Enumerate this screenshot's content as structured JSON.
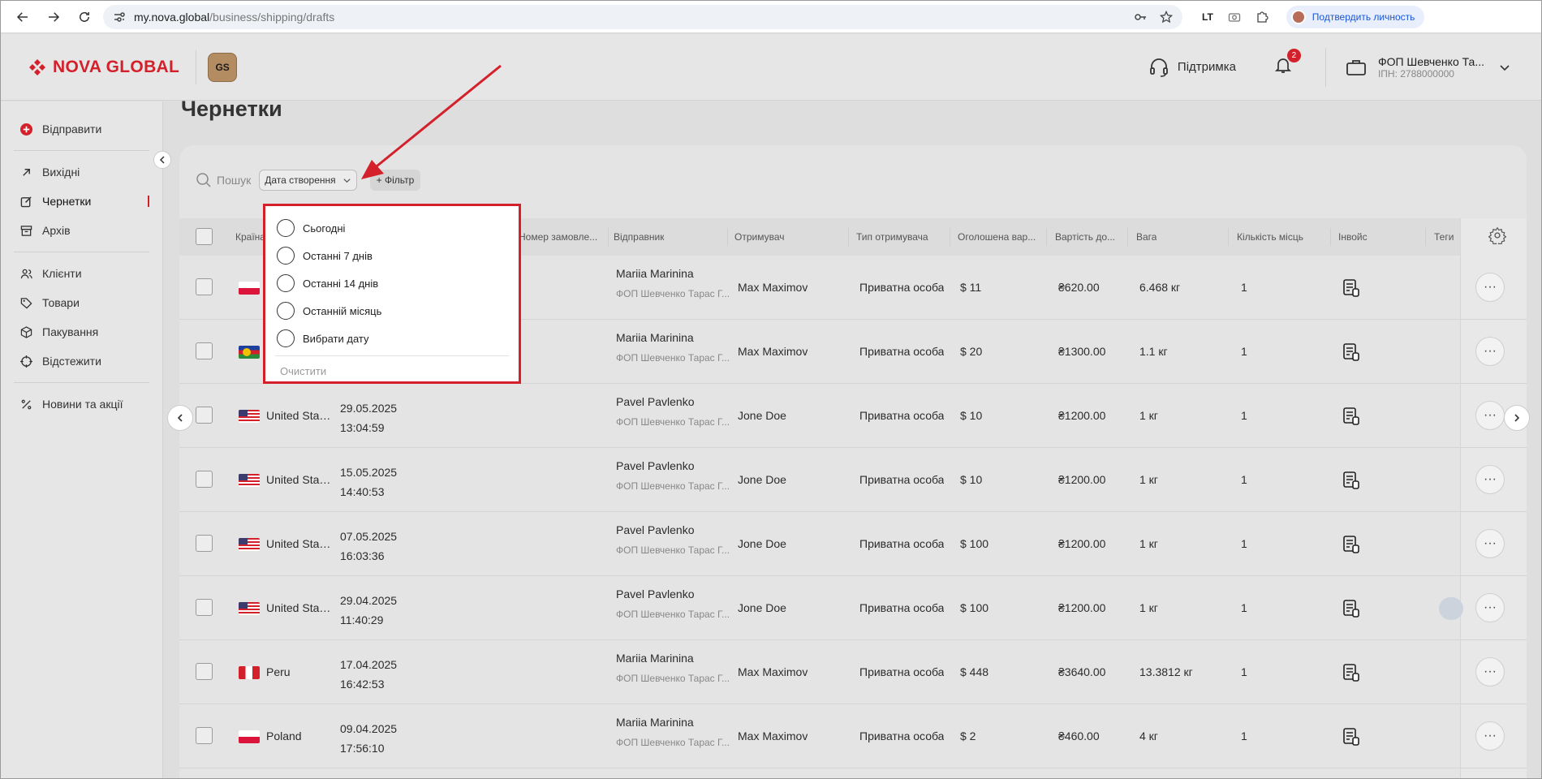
{
  "browser": {
    "url_host": "my.nova.global",
    "url_path": "/business/shipping/drafts",
    "ext_text": "LT",
    "profile_label": "Подтвердить личность"
  },
  "header": {
    "logo_text": "NOVA GLOBAL",
    "badge_text": "GS",
    "support_label": "Підтримка",
    "notifications_count": "2",
    "account_name": "ФОП Шевченко Та...",
    "account_ipn": "ІПН: 2788000000"
  },
  "sidebar": {
    "send": "Відправити",
    "outgoing": "Вихідні",
    "drafts": "Чернетки",
    "archive": "Архів",
    "clients": "Клієнти",
    "goods": "Товари",
    "packaging": "Пакування",
    "track": "Відстежити",
    "news": "Новини та акції"
  },
  "page": {
    "title": "Чернетки",
    "search_placeholder": "Пошук",
    "date_filter": "Дата створення",
    "add_filter": "+ Фільтр"
  },
  "table": {
    "headers": {
      "country": "Країна",
      "order": "Номер замовле...",
      "sender": "Відправник",
      "recipient": "Отримувач",
      "recipient_type": "Тип отримувача",
      "declared": "Оголошена вар...",
      "delivery_cost": "Вартість до...",
      "weight": "Вага",
      "places": "Кількість місць",
      "invoice": "Інвойс",
      "tags": "Теги"
    },
    "rows": [
      {
        "country": "",
        "date": "",
        "time": "",
        "sender": "Mariia Marinina",
        "sender_sub": "ФОП Шевченко Тарас Г...",
        "recipient": "Max Maximov",
        "type": "Приватна особа",
        "declared": "$ 11",
        "cost": "₴620.00",
        "weight": "6.468 кг",
        "places": "1"
      },
      {
        "country": "",
        "date": "",
        "time": "",
        "sender": "Mariia Marinina",
        "sender_sub": "ФОП Шевченко Тарас Г...",
        "recipient": "Max Maximov",
        "type": "Приватна особа",
        "declared": "$ 20",
        "cost": "₴1300.00",
        "weight": "1.1 кг",
        "places": "1"
      },
      {
        "country": "United Stat...",
        "date": "29.05.2025",
        "time": "13:04:59",
        "sender": "Pavel Pavlenko",
        "sender_sub": "ФОП Шевченко Тарас Г...",
        "recipient": "Jone Doe",
        "type": "Приватна особа",
        "declared": "$ 10",
        "cost": "₴1200.00",
        "weight": "1 кг",
        "places": "1"
      },
      {
        "country": "United Stat...",
        "date": "15.05.2025",
        "time": "14:40:53",
        "sender": "Pavel Pavlenko",
        "sender_sub": "ФОП Шевченко Тарас Г...",
        "recipient": "Jone Doe",
        "type": "Приватна особа",
        "declared": "$ 10",
        "cost": "₴1200.00",
        "weight": "1 кг",
        "places": "1"
      },
      {
        "country": "United Stat...",
        "date": "07.05.2025",
        "time": "16:03:36",
        "sender": "Pavel Pavlenko",
        "sender_sub": "ФОП Шевченко Тарас Г...",
        "recipient": "Jone Doe",
        "type": "Приватна особа",
        "declared": "$ 100",
        "cost": "₴1200.00",
        "weight": "1 кг",
        "places": "1"
      },
      {
        "country": "United Stat...",
        "date": "29.04.2025",
        "time": "11:40:29",
        "sender": "Pavel Pavlenko",
        "sender_sub": "ФОП Шевченко Тарас Г...",
        "recipient": "Jone Doe",
        "type": "Приватна особа",
        "declared": "$ 100",
        "cost": "₴1200.00",
        "weight": "1 кг",
        "places": "1"
      },
      {
        "country": "Peru",
        "date": "17.04.2025",
        "time": "16:42:53",
        "sender": "Mariia Marinina",
        "sender_sub": "ФОП Шевченко Тарас Г...",
        "recipient": "Max Maximov",
        "type": "Приватна особа",
        "declared": "$ 448",
        "cost": "₴3640.00",
        "weight": "13.3812 кг",
        "places": "1"
      },
      {
        "country": "Poland",
        "date": "09.04.2025",
        "time": "17:56:10",
        "sender": "Mariia Marinina",
        "sender_sub": "ФОП Шевченко Тарас Г...",
        "recipient": "Max Maximov",
        "type": "Приватна особа",
        "declared": "$ 2",
        "cost": "₴460.00",
        "weight": "4 кг",
        "places": "1"
      }
    ],
    "more_symbol": "···"
  },
  "dropdown": {
    "options": [
      "Сьогодні",
      "Останні 7 днів",
      "Останні 14 днів",
      "Останній місяць",
      "Вибрати дату"
    ],
    "clear": "Очистити"
  },
  "colors": {
    "brand_red": "#d4202a",
    "accent_blue": "#1a56d6"
  }
}
